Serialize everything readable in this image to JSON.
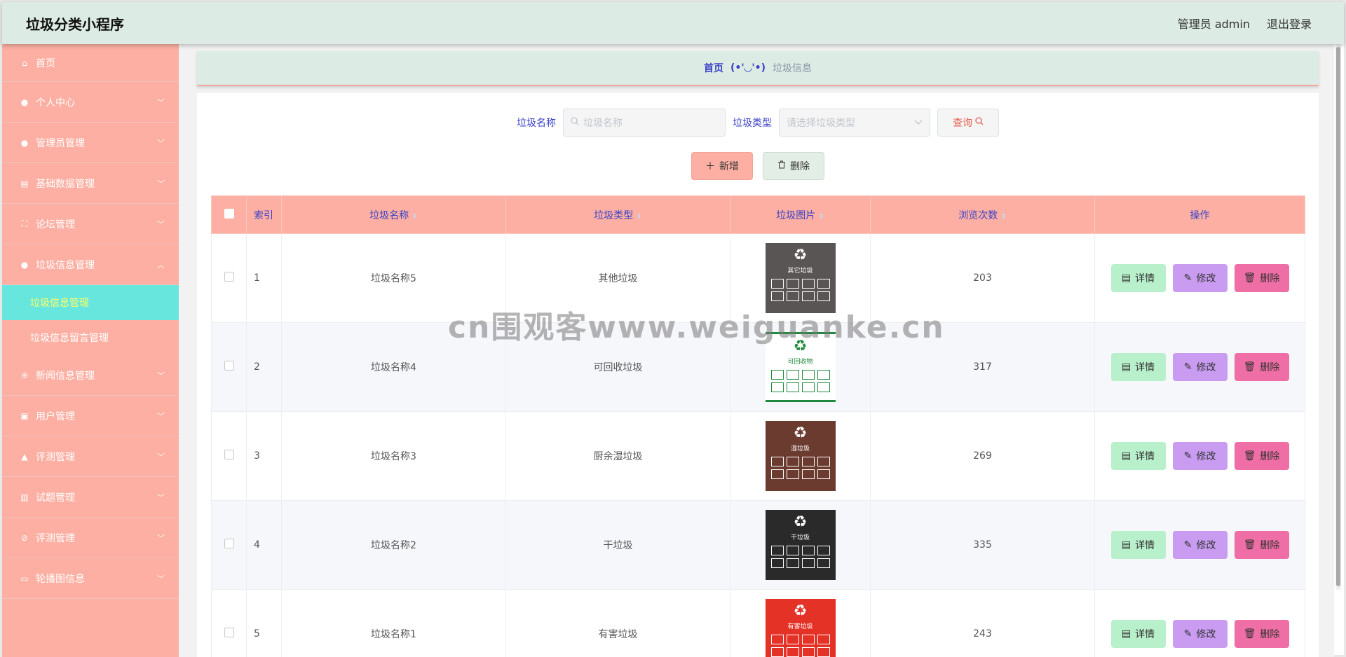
{
  "app": {
    "title": "垃圾分类小程序",
    "user_label": "管理员 admin",
    "logout_label": "退出登录"
  },
  "sidebar": {
    "items": [
      {
        "label": "首页",
        "icon": "home-icon",
        "has_chevron": false
      },
      {
        "label": "个人中心",
        "icon": "user-icon",
        "has_chevron": true
      },
      {
        "label": "管理员管理",
        "icon": "user-icon",
        "has_chevron": true
      },
      {
        "label": "基础数据管理",
        "icon": "chart-icon",
        "has_chevron": true
      },
      {
        "label": "论坛管理",
        "icon": "frame-icon",
        "has_chevron": true
      },
      {
        "label": "垃圾信息管理",
        "icon": "bulb-icon",
        "has_chevron": true,
        "expanded": true,
        "children": [
          {
            "label": "垃圾信息管理",
            "active": true
          },
          {
            "label": "垃圾信息留言管理",
            "active": false
          }
        ]
      },
      {
        "label": "新闻信息管理",
        "icon": "globe-icon",
        "has_chevron": true
      },
      {
        "label": "用户管理",
        "icon": "briefcase-icon",
        "has_chevron": true
      },
      {
        "label": "评测管理",
        "icon": "thumb-icon",
        "has_chevron": true
      },
      {
        "label": "试题管理",
        "icon": "clipboard-icon",
        "has_chevron": true
      },
      {
        "label": "评测管理",
        "icon": "compass-icon",
        "has_chevron": true
      },
      {
        "label": "轮播图信息",
        "icon": "monitor-icon",
        "has_chevron": true
      }
    ]
  },
  "breadcrumb": {
    "home": "首页",
    "separator": "(•'◡'•)",
    "current": "垃圾信息"
  },
  "search": {
    "name_label": "垃圾名称",
    "name_placeholder": "垃圾名称",
    "type_label": "垃圾类型",
    "type_placeholder": "请选择垃圾类型",
    "query_label": "查询"
  },
  "actions": {
    "add_label": "新增",
    "delete_label": "删除"
  },
  "table": {
    "headers": {
      "index": "索引",
      "name": "垃圾名称",
      "type": "垃圾类型",
      "image": "垃圾图片",
      "views": "浏览次数",
      "ops": "操作"
    },
    "op_labels": {
      "detail": "详情",
      "edit": "修改",
      "delete": "删除"
    },
    "rows": [
      {
        "index": "1",
        "name": "垃圾名称5",
        "type": "其他垃圾",
        "views": "203",
        "img_color": "#5a5555",
        "img_text": "其它垃圾"
      },
      {
        "index": "2",
        "name": "垃圾名称4",
        "type": "可回收垃圾",
        "views": "317",
        "img_color": "#ffffff",
        "img_text": "可回收物"
      },
      {
        "index": "3",
        "name": "垃圾名称3",
        "type": "厨余湿垃圾",
        "views": "269",
        "img_color": "#6b3b2f",
        "img_text": "湿垃圾"
      },
      {
        "index": "4",
        "name": "垃圾名称2",
        "type": "干垃圾",
        "views": "335",
        "img_color": "#2a2a2a",
        "img_text": "干垃圾"
      },
      {
        "index": "5",
        "name": "垃圾名称1",
        "type": "有害垃圾",
        "views": "243",
        "img_color": "#e53227",
        "img_text": "有害垃圾"
      }
    ]
  },
  "watermark": "cn围观客www.weiguanke.cn"
}
